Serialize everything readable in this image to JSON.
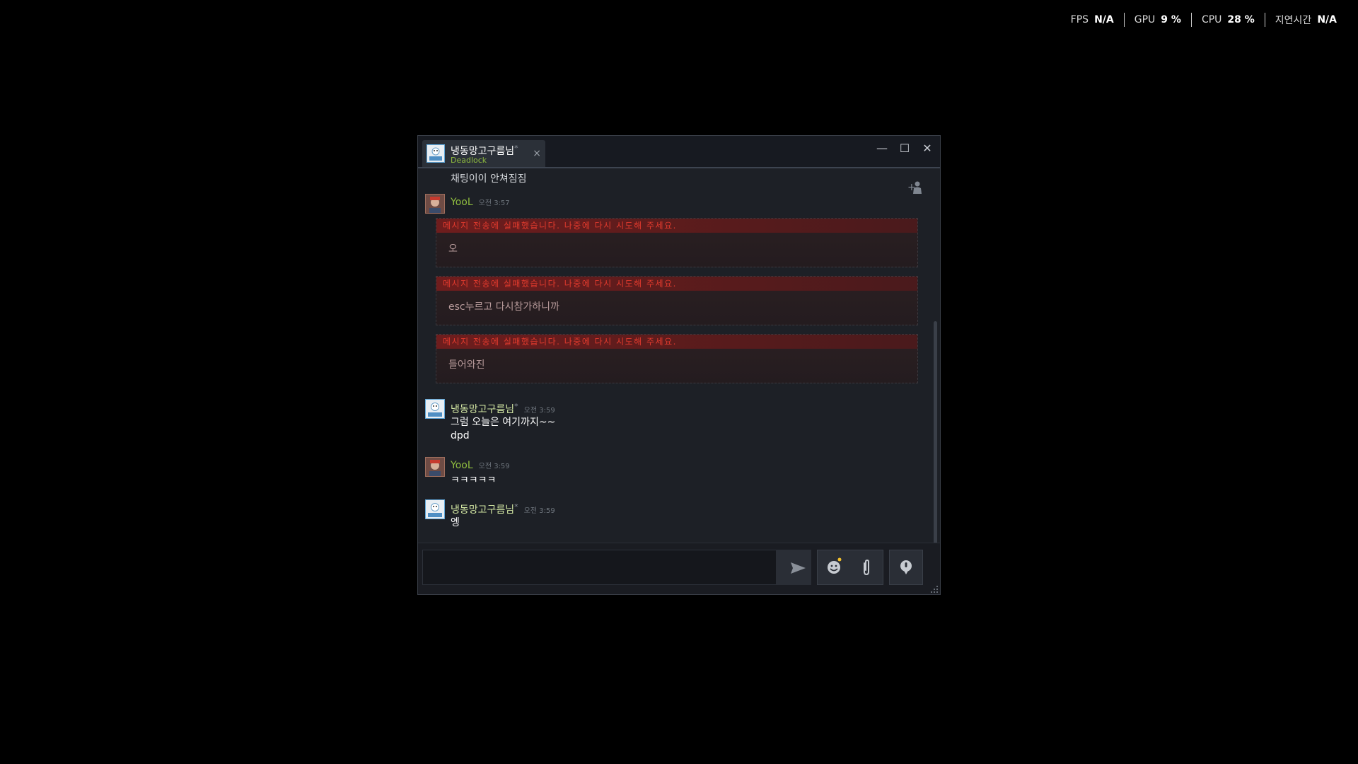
{
  "overlay": {
    "fps_label": "FPS",
    "fps_value": "N/A",
    "gpu_label": "GPU",
    "gpu_value": "9 %",
    "cpu_label": "CPU",
    "cpu_value": "28 %",
    "latency_label": "지연시간",
    "latency_value": "N/A"
  },
  "window": {
    "tab": {
      "name": "냉동망고구름님",
      "badge": "*",
      "game": "Deadlock",
      "close": "×"
    },
    "controls": {
      "minimize": "—",
      "maximize": "☐",
      "close": "✕"
    }
  },
  "chat": {
    "prev_line": "채팅이이 안쳐짐짐",
    "failure_text": "메시지 전송에 실패했습니다. 나중에 다시 시도해 주세요.",
    "groups": [
      {
        "sender": "YooL",
        "time": "오전 3:57",
        "failed": [
          "오",
          "esc누르고 다시참가하니까",
          "들어와진"
        ]
      },
      {
        "sender": "냉동망고구름님",
        "badge": "*",
        "time": "오전 3:59",
        "lines": [
          "그럼 오늘은 여기까지~~",
          "dpd"
        ]
      },
      {
        "sender": "YooL",
        "time": "오전 3:59",
        "lines": [
          "ㅋㅋㅋㅋㅋ"
        ]
      },
      {
        "sender": "냉동망고구름님",
        "badge": "*",
        "time": "오전 3:59",
        "lines": [
          "엥"
        ]
      }
    ]
  },
  "input": {
    "value": "",
    "placeholder": ""
  },
  "colors": {
    "accent_green": "#8fbc3f",
    "failure_red": "#e03a2d",
    "window_bg": "#1d2026",
    "title_bg": "#171a21"
  },
  "icons": [
    "minimize-icon",
    "maximize-icon",
    "close-icon",
    "invite-friend-icon",
    "send-icon",
    "emoji-icon",
    "attach-icon",
    "voice-icon",
    "resize-grip-icon"
  ]
}
